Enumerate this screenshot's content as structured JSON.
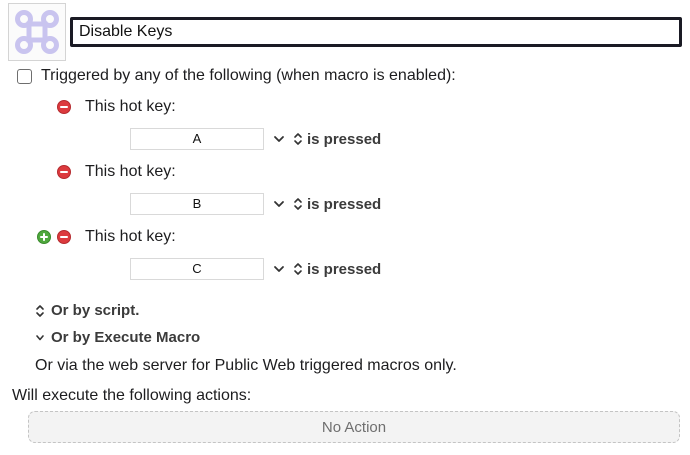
{
  "macro": {
    "icon": "command-key-icon",
    "name": "Disable Keys"
  },
  "triggers": {
    "checkbox_label": "Triggered by any of the following (when macro is enabled):",
    "checked": false,
    "hotkeys": [
      {
        "label": "This hot key:",
        "key": "A",
        "condition": "is pressed"
      },
      {
        "label": "This hot key:",
        "key": "B",
        "condition": "is pressed"
      },
      {
        "label": "This hot key:",
        "key": "C",
        "condition": "is pressed"
      }
    ],
    "or_by_script": "Or by script.",
    "or_by_execute_macro": "Or by Execute Macro",
    "web_server_note": "Or via the web server for Public Web triggered macros only."
  },
  "actions": {
    "heading": "Will execute the following actions:",
    "placeholder": "No Action"
  },
  "colors": {
    "remove_button": "#dc3a3e",
    "add_button": "#4fa83d",
    "icon_tint": "#c9c4ef"
  }
}
